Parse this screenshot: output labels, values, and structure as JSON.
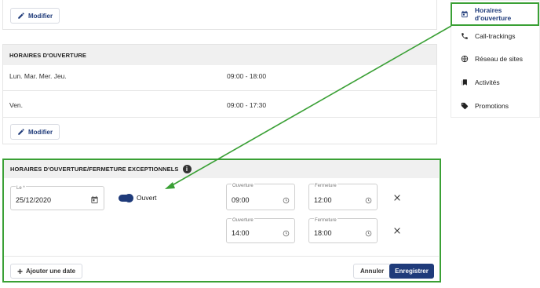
{
  "top_section": {
    "modify_label": "Modifier"
  },
  "opening_hours": {
    "header": "HORAIRES D'OUVERTURE",
    "rows": [
      {
        "days": "Lun. Mar. Mer. Jeu.",
        "hours": "09:00 - 18:00"
      },
      {
        "days": "Ven.",
        "hours": "09:00 - 17:30"
      }
    ],
    "modify_label": "Modifier"
  },
  "exceptional": {
    "header": "HORAIRES D'OUVERTURE/FERMETURE EXCEPTIONNELS",
    "date_label": "Le *",
    "date_value": "25/12/2020",
    "status_label": "Ouvert",
    "slots": [
      {
        "open_label": "Ouverture",
        "open_value": "09:00",
        "close_label": "Fermeture",
        "close_value": "12:00"
      },
      {
        "open_label": "Ouverture",
        "open_value": "14:00",
        "close_label": "Fermeture",
        "close_value": "18:00"
      }
    ],
    "add_date_label": "Ajouter une date",
    "cancel_label": "Annuler",
    "save_label": "Enregistrer"
  },
  "sidebar": {
    "items": [
      {
        "label": "Horaires d'ouverture",
        "icon": "calendar-icon",
        "active": true
      },
      {
        "label": "Call-trackings",
        "icon": "phone-icon"
      },
      {
        "label": "Réseau de sites",
        "icon": "globe-icon"
      },
      {
        "label": "Activités",
        "icon": "bookmarks-icon"
      },
      {
        "label": "Promotions",
        "icon": "tag-icon"
      }
    ]
  },
  "colors": {
    "brand": "#1f3b7a",
    "annotation": "#3aa035",
    "header_bg": "#f0f0f0"
  }
}
